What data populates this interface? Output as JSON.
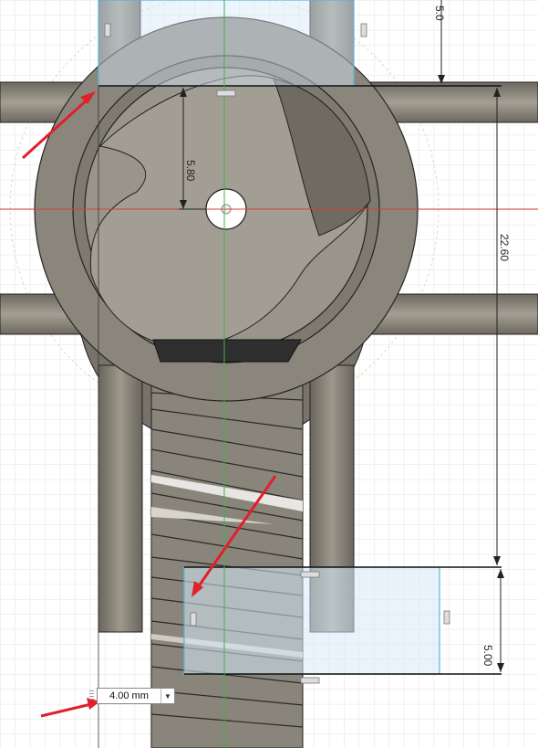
{
  "dimensions": {
    "top_offset": "5.0",
    "radius_offset": "5.80",
    "vertical_span": "22.60",
    "bottom_height": "5.00"
  },
  "value_input": {
    "value": "4.00 mm",
    "dropdown_icon": "chevron-down-icon"
  },
  "colors": {
    "part_body": "#7f7a70",
    "part_light": "#a7a197",
    "selection_fill": "#d6e9f8",
    "selection_edge": "#5ab4d6",
    "x_axis": "#e03a3a",
    "y_axis": "#3cb34a",
    "annotation_arrow": "#e0202a"
  }
}
